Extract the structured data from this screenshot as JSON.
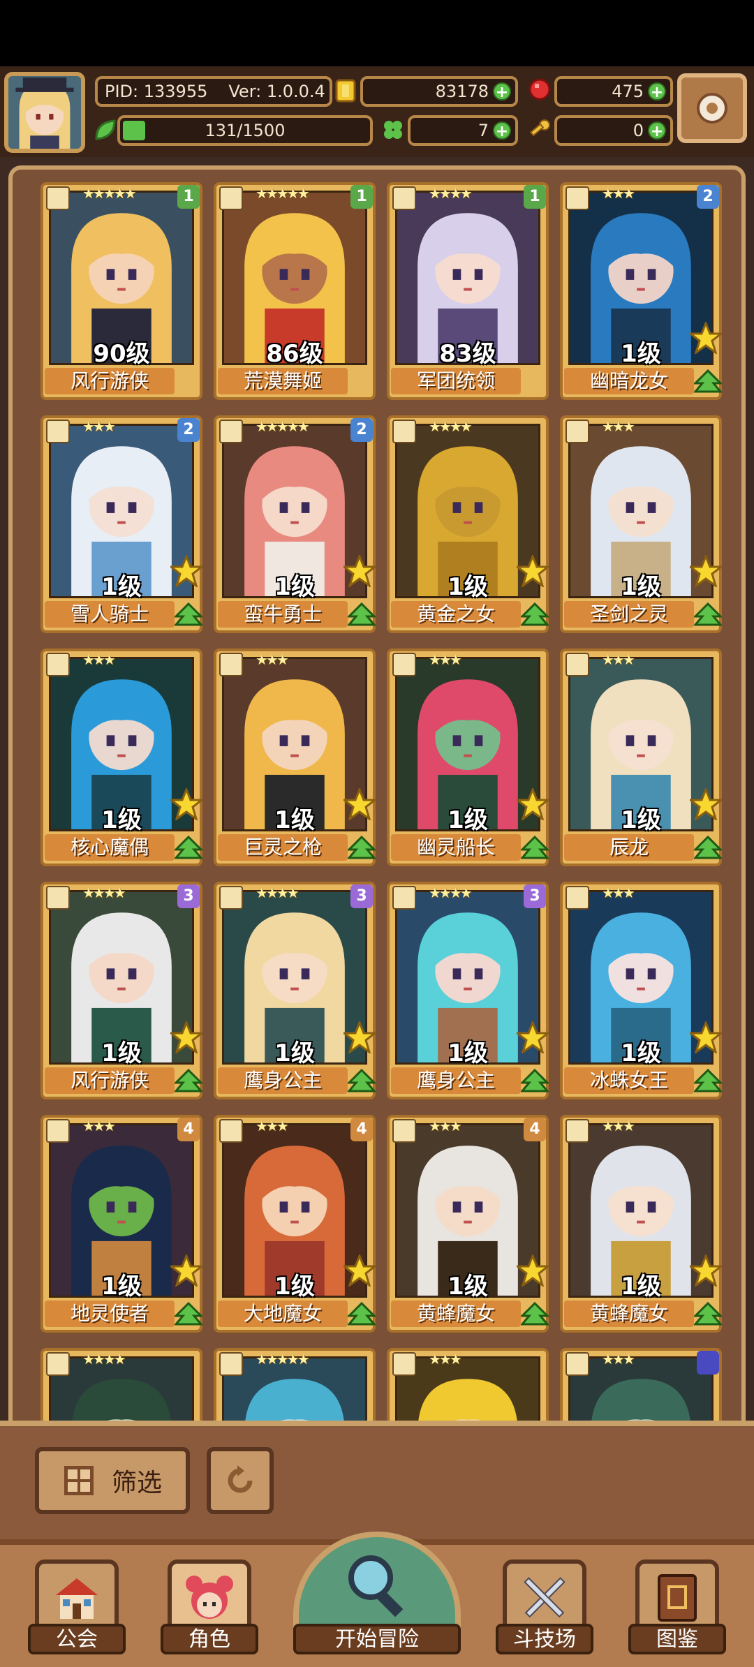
{
  "header": {
    "pid": "PID: 133955",
    "version": "Ver: 1.0.0.4",
    "gold": "83178",
    "gems": "475",
    "stamina": "131/1500",
    "clover": "7",
    "keys": "0"
  },
  "heroes": [
    {
      "name": "风行游侠",
      "level": "90级",
      "badge": "1",
      "badge_color": "b1",
      "stars": "★★★★★",
      "up": false,
      "hair": "#f0c060",
      "skin": "#f6d2b4",
      "cloth": "#2a2a3a",
      "bg": "#3a5060"
    },
    {
      "name": "荒漠舞姬",
      "level": "86级",
      "badge": "1",
      "badge_color": "b1",
      "stars": "★★★★★",
      "up": false,
      "hair": "#f2c24a",
      "skin": "#b8764a",
      "cloth": "#c83a2a",
      "bg": "#7a4a2a"
    },
    {
      "name": "军团统领",
      "level": "83级",
      "badge": "1",
      "badge_color": "b1",
      "stars": "★★★★",
      "up": false,
      "hair": "#d8d0ea",
      "skin": "#f6dcd0",
      "cloth": "#5a4a7a",
      "bg": "#4a3a5a"
    },
    {
      "name": "幽暗龙女",
      "level": "1级",
      "badge": "2",
      "badge_color": "b2",
      "stars": "★★★",
      "up": true,
      "hair": "#2a7ac0",
      "skin": "#e8d0c8",
      "cloth": "#1a3a5a",
      "bg": "#143048"
    },
    {
      "name": "雪人骑士",
      "level": "1级",
      "badge": "2",
      "badge_color": "b2",
      "stars": "★★★",
      "up": true,
      "hair": "#e8eef6",
      "skin": "#f4e0d4",
      "cloth": "#6aa0d0",
      "bg": "#3a5a7a"
    },
    {
      "name": "蛮牛勇士",
      "level": "1级",
      "badge": "2",
      "badge_color": "b2",
      "stars": "★★★★★",
      "up": true,
      "hair": "#e88a80",
      "skin": "#f6d8c8",
      "cloth": "#f0e8e0",
      "bg": "#5a3a2a"
    },
    {
      "name": "黄金之女",
      "level": "1级",
      "badge": "",
      "badge_color": "",
      "stars": "★★★★",
      "up": true,
      "hair": "#d8a830",
      "skin": "#c89a30",
      "cloth": "#b08020",
      "bg": "#4a3820"
    },
    {
      "name": "圣剑之灵",
      "level": "1级",
      "badge": "",
      "badge_color": "",
      "stars": "★★★",
      "up": true,
      "hair": "#e0e6f0",
      "skin": "#f4e0d0",
      "cloth": "#c8b088",
      "bg": "#6a4a30"
    },
    {
      "name": "核心魔偶",
      "level": "1级",
      "badge": "",
      "badge_color": "",
      "stars": "★★★",
      "up": true,
      "hair": "#2a9ad8",
      "skin": "#e8d8d0",
      "cloth": "#1a4a5a",
      "bg": "#1a3a3a"
    },
    {
      "name": "巨灵之枪",
      "level": "1级",
      "badge": "",
      "badge_color": "",
      "stars": "★★★",
      "up": true,
      "hair": "#f0b84a",
      "skin": "#f4d4b8",
      "cloth": "#2a2a2a",
      "bg": "#5a3a2a"
    },
    {
      "name": "幽灵船长",
      "level": "1级",
      "badge": "",
      "badge_color": "",
      "stars": "★★★",
      "up": true,
      "hair": "#e04a6a",
      "skin": "#7ab88a",
      "cloth": "#2a4a3a",
      "bg": "#2a3a2a"
    },
    {
      "name": "辰龙",
      "level": "1级",
      "badge": "",
      "badge_color": "",
      "stars": "★★★",
      "up": true,
      "hair": "#f0e0c0",
      "skin": "#f6e0d0",
      "cloth": "#4a90b0",
      "bg": "#3a5a5a"
    },
    {
      "name": "风行游侠",
      "level": "1级",
      "badge": "3",
      "badge_color": "b3",
      "stars": "★★★★",
      "up": true,
      "hair": "#e8e8e8",
      "skin": "#f4d8c8",
      "cloth": "#2a5a4a",
      "bg": "#3a4a3a"
    },
    {
      "name": "鹰身公主",
      "level": "1级",
      "badge": "3",
      "badge_color": "b3",
      "stars": "★★★★",
      "up": true,
      "hair": "#f0d8a0",
      "skin": "#f6dcc4",
      "cloth": "#3a5a5a",
      "bg": "#2a4a4a"
    },
    {
      "name": "鹰身公主",
      "level": "1级",
      "badge": "3",
      "badge_color": "b3",
      "stars": "★★★★",
      "up": true,
      "hair": "#5ad0d8",
      "skin": "#f0d8d0",
      "cloth": "#a07050",
      "bg": "#2a4a6a"
    },
    {
      "name": "冰蛛女王",
      "level": "1级",
      "badge": "",
      "badge_color": "",
      "stars": "★★★",
      "up": true,
      "hair": "#4ab0e0",
      "skin": "#f0e0e0",
      "cloth": "#2a6a8a",
      "bg": "#1a3a5a"
    },
    {
      "name": "地灵使者",
      "level": "1级",
      "badge": "4",
      "badge_color": "b4",
      "stars": "★★★",
      "up": true,
      "hair": "#1a2a4a",
      "skin": "#6ab04a",
      "cloth": "#c08040",
      "bg": "#3a2a3a"
    },
    {
      "name": "大地魔女",
      "level": "1级",
      "badge": "4",
      "badge_color": "b4",
      "stars": "★★★",
      "up": true,
      "hair": "#d86a3a",
      "skin": "#f4d0b0",
      "cloth": "#a03a2a",
      "bg": "#4a2a1a"
    },
    {
      "name": "黄蜂魔女",
      "level": "1级",
      "badge": "4",
      "badge_color": "b4",
      "stars": "★★★",
      "up": true,
      "hair": "#e8e4e0",
      "skin": "#f4dcc8",
      "cloth": "#3a2a1a",
      "bg": "#4a3a2a"
    },
    {
      "name": "黄蜂魔女",
      "level": "1级",
      "badge": "",
      "badge_color": "",
      "stars": "★★★",
      "up": true,
      "hair": "#e0e4ea",
      "skin": "#f6e0d0",
      "cloth": "#c8a040",
      "bg": "#4a3a30"
    },
    {
      "name": "",
      "level": "",
      "badge": "",
      "badge_color": "",
      "stars": "★★★★",
      "up": false,
      "hair": "#2a4a3a",
      "skin": "#c8d8c0",
      "cloth": "#2a3a3a",
      "bg": "#2a3a3a"
    },
    {
      "name": "",
      "level": "",
      "badge": "",
      "badge_color": "",
      "stars": "★★★★★",
      "up": false,
      "hair": "#4ab0d0",
      "skin": "#c8e0e8",
      "cloth": "#2a6a8a",
      "bg": "#2a4a5a"
    },
    {
      "name": "",
      "level": "",
      "badge": "",
      "badge_color": "",
      "stars": "★★★",
      "up": false,
      "hair": "#f0c830",
      "skin": "#f0d8a0",
      "cloth": "#d8a820",
      "bg": "#4a3a1a"
    },
    {
      "name": "",
      "level": "",
      "badge": "",
      "badge_color": "b5",
      "stars": "★★★",
      "up": false,
      "hair": "#3a6a5a",
      "skin": "#c0d0c0",
      "cloth": "#2a4a4a",
      "bg": "#2a3a3a"
    }
  ],
  "filter": {
    "label": "筛选"
  },
  "nav": {
    "guild": "公会",
    "role": "角色",
    "adventure": "开始冒险",
    "arena": "斗技场",
    "codex": "图鉴"
  }
}
